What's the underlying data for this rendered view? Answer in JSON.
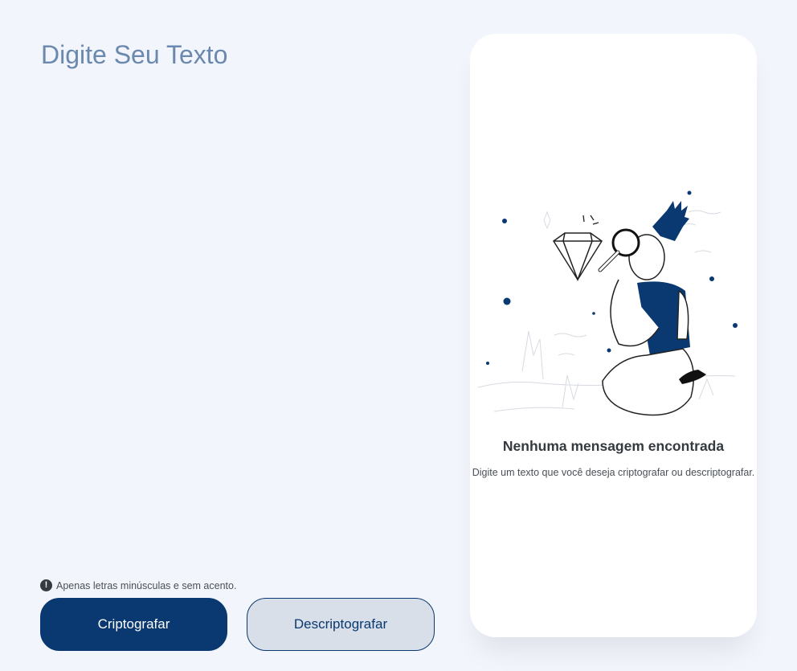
{
  "input": {
    "placeholder": "Digite Seu Texto",
    "value": ""
  },
  "hint": {
    "icon": "info-icon",
    "text": "Apenas letras minúsculas e sem acento."
  },
  "buttons": {
    "encrypt_label": "Criptografar",
    "decrypt_label": "Descriptografar"
  },
  "output": {
    "illustration": "person-with-magnifying-glass-and-diamond",
    "empty_title": "Nenhuma mensagem encontrada",
    "empty_description": "Digite um texto que você deseja criptografar ou descriptografar."
  },
  "colors": {
    "background": "#f2f5fc",
    "primary": "#0a3871",
    "secondary_button": "#d8dfe8",
    "placeholder_text": "#6b88ae",
    "panel": "#ffffff"
  }
}
